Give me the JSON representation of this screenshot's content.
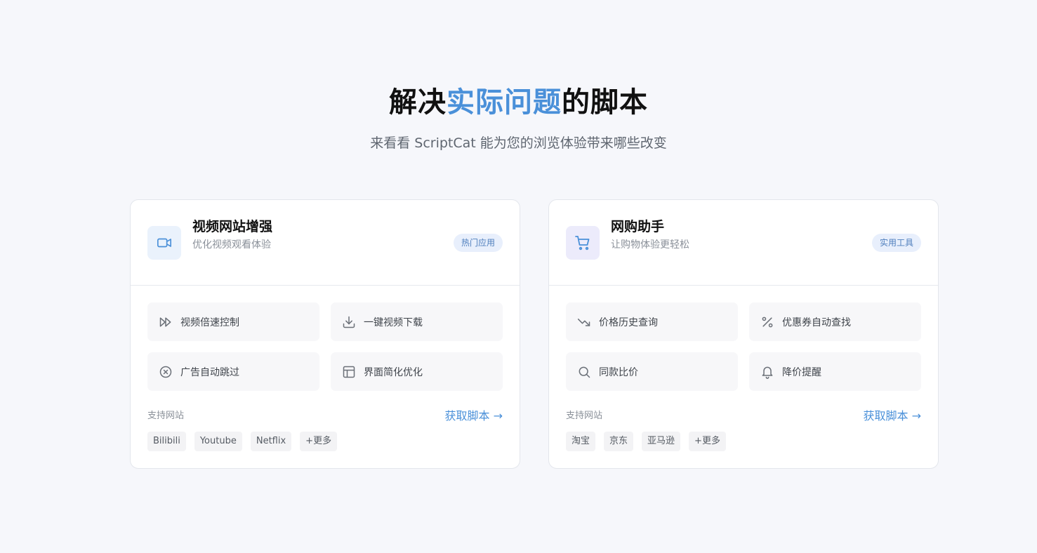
{
  "section": {
    "title_pre": "解决",
    "title_accent": "实际问题",
    "title_post": "的脚本",
    "subtitle": "来看看 ScriptCat 能为您的浏览体验带来哪些改变"
  },
  "colors": {
    "accent": "#4a90d9",
    "background": "#f6f7fb"
  },
  "cards": [
    {
      "icon": "video-camera-icon",
      "title": "视频网站增强",
      "description": "优化视频观看体验",
      "badge": "热门应用",
      "features": [
        {
          "icon": "fast-forward-icon",
          "label": "视频倍速控制"
        },
        {
          "icon": "download-icon",
          "label": "一键视频下载"
        },
        {
          "icon": "close-circle-icon",
          "label": "广告自动跳过"
        },
        {
          "icon": "layout-icon",
          "label": "界面简化优化"
        }
      ],
      "support_label": "支持网站",
      "link_label": "获取脚本 →",
      "sites": [
        "Bilibili",
        "Youtube",
        "Netflix",
        "+更多"
      ]
    },
    {
      "icon": "shopping-cart-icon",
      "title": "网购助手",
      "description": "让购物体验更轻松",
      "badge": "实用工具",
      "features": [
        {
          "icon": "trending-down-icon",
          "label": "价格历史查询"
        },
        {
          "icon": "percent-icon",
          "label": "优惠券自动查找"
        },
        {
          "icon": "search-icon",
          "label": "同款比价"
        },
        {
          "icon": "bell-icon",
          "label": "降价提醒"
        }
      ],
      "support_label": "支持网站",
      "link_label": "获取脚本 →",
      "sites": [
        "淘宝",
        "京东",
        "亚马逊",
        "+更多"
      ]
    }
  ]
}
